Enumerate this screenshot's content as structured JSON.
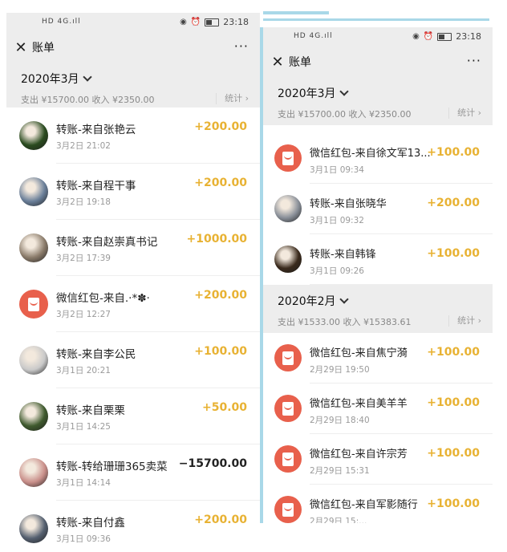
{
  "left": {
    "status": {
      "signal": "HD 4G.ıll",
      "time": "23:18"
    },
    "nav": {
      "title": "账单",
      "more": "···"
    },
    "month": {
      "label": "2020年3月",
      "summary": "支出 ¥15700.00 收入 ¥2350.00",
      "stat": "统计 ›"
    },
    "items": [
      {
        "title": "转账-来自张艳云",
        "time": "3月2日 21:02",
        "amount": "+200.00",
        "avatar": "flower-photo",
        "color": "#2a4b1f"
      },
      {
        "title": "转账-来自程干事",
        "time": "3月2日 19:18",
        "amount": "+200.00",
        "avatar": "person-photo",
        "color": "#6a7f99"
      },
      {
        "title": "转账-来自赵崇真书记",
        "time": "3月2日 17:39",
        "amount": "+1000.00",
        "avatar": "couple-photo",
        "color": "#8a7b6a"
      },
      {
        "title": "微信红包-来自.·*✽·",
        "time": "3月2日 12:27",
        "amount": "+200.00",
        "avatar": "red-packet",
        "color": "#e8604c"
      },
      {
        "title": "转账-来自李公民",
        "time": "3月1日 20:21",
        "amount": "+100.00",
        "avatar": "snow-photo",
        "color": "#c9c9c9"
      },
      {
        "title": "转账-来自栗栗",
        "time": "3月1日 14:25",
        "amount": "+50.00",
        "avatar": "lily-photo",
        "color": "#3f5a2e"
      },
      {
        "title": "转账-转给珊珊365卖菜",
        "time": "3月1日 14:14",
        "amount": "−15700.00",
        "avatar": "family-photo",
        "color": "#c98f8a",
        "negative": true
      },
      {
        "title": "转账-来自付鑫",
        "time": "3月1日 09:36",
        "amount": "+200.00",
        "avatar": "man-photo",
        "color": "#556070"
      }
    ]
  },
  "right": {
    "status": {
      "signal": "HD 4G.ıll",
      "time": "23:18"
    },
    "nav": {
      "title": "账单",
      "more": "···"
    },
    "month1": {
      "label": "2020年3月",
      "summary": "支出 ¥15700.00 收入 ¥2350.00",
      "stat": "统计 ›"
    },
    "items1": [
      {
        "title": "微信红包-来自徐文军13...",
        "time": "3月1日 09:34",
        "amount": "+100.00",
        "avatar": "red-packet",
        "color": "#e8604c"
      },
      {
        "title": "转账-来自张晓华",
        "time": "3月1日 09:32",
        "amount": "+200.00",
        "avatar": "group-photo",
        "color": "#8a9099"
      },
      {
        "title": "转账-来自韩锋",
        "time": "3月1日 09:26",
        "amount": "+100.00",
        "avatar": "dark-photo",
        "color": "#3a2a1c"
      }
    ],
    "month2": {
      "label": "2020年2月",
      "summary": "支出 ¥1533.00 收入 ¥15383.61",
      "stat": "统计 ›"
    },
    "items2": [
      {
        "title": "微信红包-来自焦宁漪",
        "time": "2月29日 19:50",
        "amount": "+100.00",
        "avatar": "red-packet",
        "color": "#e8604c"
      },
      {
        "title": "微信红包-来自美羊羊",
        "time": "2月29日 18:40",
        "amount": "+100.00",
        "avatar": "red-packet",
        "color": "#e8604c"
      },
      {
        "title": "微信红包-来自许宗芳",
        "time": "2月29日 15:31",
        "amount": "+100.00",
        "avatar": "red-packet",
        "color": "#e8604c"
      },
      {
        "title": "微信红包-来自军影随行",
        "time": "2月29日 15:...",
        "amount": "+100.00",
        "avatar": "red-packet",
        "color": "#e8604c"
      }
    ]
  }
}
